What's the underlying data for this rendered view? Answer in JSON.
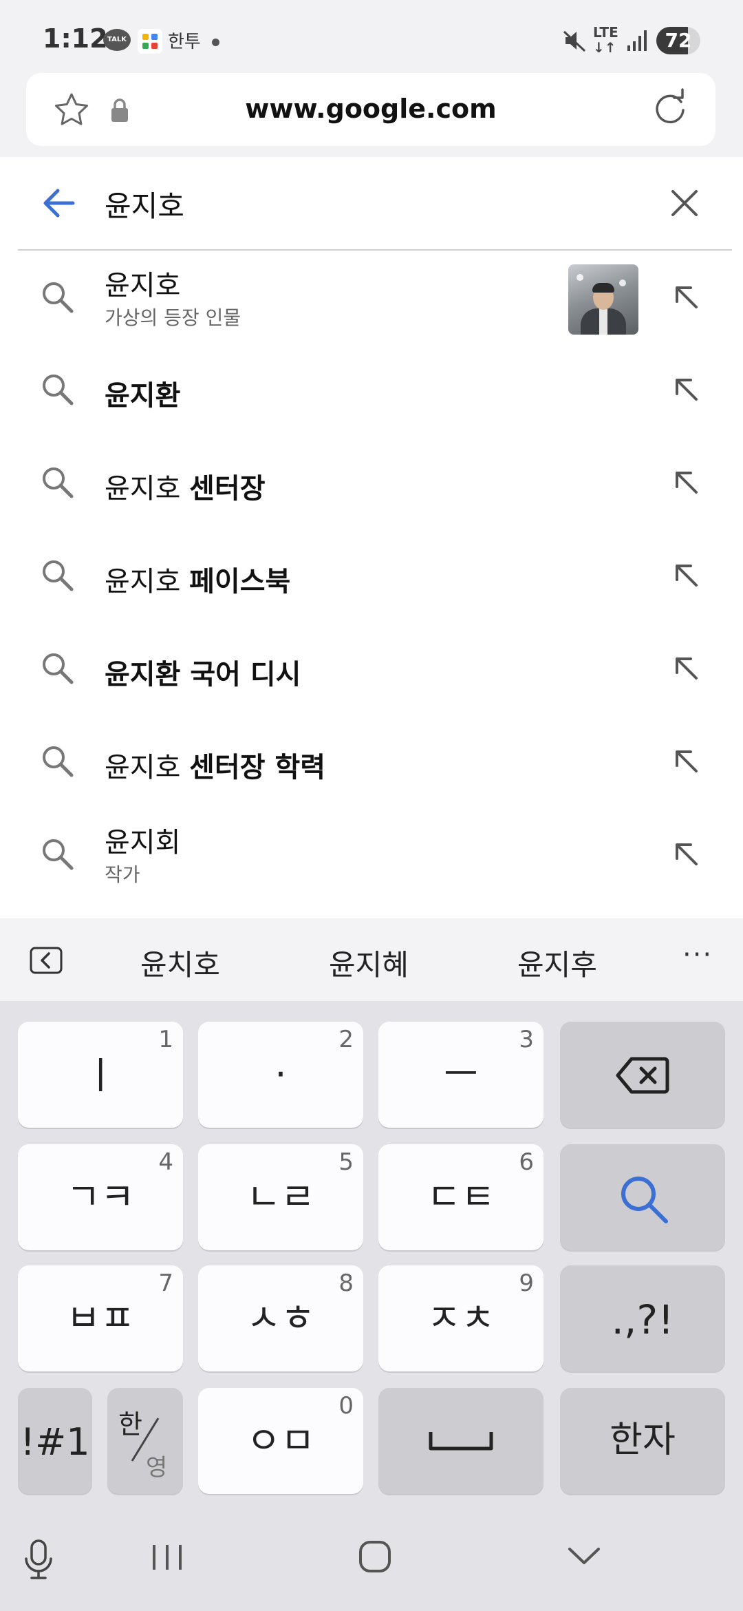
{
  "status_bar": {
    "time": "1:12",
    "talk_badge": "TALK",
    "han_label": "한투",
    "battery_level": "72"
  },
  "url_bar": {
    "url": "www.google.com"
  },
  "search": {
    "query": "윤지호",
    "suggestions": [
      {
        "plain": "윤지호",
        "bold": "",
        "subtitle": "가상의 등장 인물",
        "has_thumbnail": true
      },
      {
        "plain": "",
        "bold": "윤지환",
        "subtitle": ""
      },
      {
        "plain": "윤지호 ",
        "bold": "센터장",
        "subtitle": ""
      },
      {
        "plain": "윤지호 ",
        "bold": "페이스북",
        "subtitle": ""
      },
      {
        "plain": "",
        "bold": "윤지환 국어 디시",
        "subtitle": ""
      },
      {
        "plain": "윤지호 ",
        "bold": "센터장 학력",
        "subtitle": ""
      },
      {
        "plain": "윤지회",
        "bold": "",
        "subtitle": "작가"
      }
    ]
  },
  "keyboard_suggestions": {
    "words": [
      "윤치호",
      "윤지혜",
      "윤지후"
    ],
    "more_label": "···"
  },
  "keyboard": {
    "row1": [
      {
        "label": "ㅣ",
        "num": "1"
      },
      {
        "label": "·",
        "num": "2"
      },
      {
        "label": "ㅡ",
        "num": "3"
      }
    ],
    "row2": [
      {
        "label": "ㄱㅋ",
        "num": "4"
      },
      {
        "label": "ㄴㄹ",
        "num": "5"
      },
      {
        "label": "ㄷㅌ",
        "num": "6"
      }
    ],
    "row3": [
      {
        "label": "ㅂㅍ",
        "num": "7"
      },
      {
        "label": "ㅅㅎ",
        "num": "8"
      },
      {
        "label": "ㅈㅊ",
        "num": "9"
      }
    ],
    "punct_label": ".,?!",
    "symbols_label": "!#1",
    "lang_top": "한",
    "lang_bottom": "영",
    "zero_key": {
      "label": "ㅇㅁ",
      "num": "0"
    },
    "hanja_label": "한자"
  },
  "colors": {
    "accent_blue": "#3b6fd4",
    "panel_bg": "#ffffff",
    "keyboard_bg": "#e3e3e7"
  }
}
